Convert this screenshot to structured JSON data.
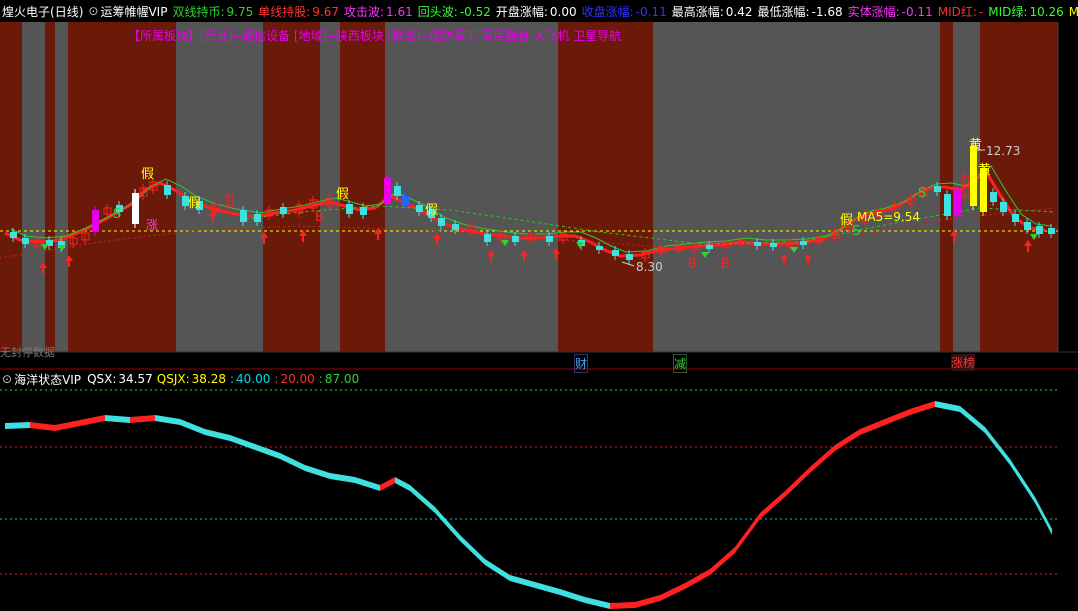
{
  "header": {
    "stock_name": "煌火电子",
    "period": "(日线)",
    "indicator_name": "运筹帷幄VIP",
    "items": [
      {
        "label": "双线持币:",
        "value": "9.75",
        "color": "#32d232"
      },
      {
        "label": "单线持股:",
        "value": "9.67",
        "color": "#ff3232"
      },
      {
        "label": "攻击波:",
        "value": "1.61",
        "color": "#ff32ff"
      },
      {
        "label": "回头波:",
        "value": "-0.52",
        "color": "#32ff32"
      },
      {
        "label": "开盘涨幅:",
        "value": "0.00",
        "color": "#ffffff"
      },
      {
        "label": "收盘涨幅:",
        "value": "-0.11",
        "color": "#3232ff"
      },
      {
        "label": "最高涨幅:",
        "value": "0.42",
        "color": "#ffffff"
      },
      {
        "label": "最低涨幅:",
        "value": "-1.68",
        "color": "#ffffff"
      },
      {
        "label": "实体涨幅:",
        "value": "-0.11",
        "color": "#ff32ff"
      },
      {
        "label": "MID红:",
        "value": "-",
        "color": "#ff3232"
      },
      {
        "label": "MID绿:",
        "value": "10.26",
        "color": "#32ff32"
      },
      {
        "label": "M",
        "value": "",
        "color": "#ffff00"
      }
    ]
  },
  "sector_line": "【所属板块】[行业]--通信设备 [地域]--陕西板块 [概念]--国防军工 军民融合 大飞机 卫星导航",
  "annotations": {
    "fake": "假",
    "buy": "B",
    "sell": "S",
    "yellow": "黄",
    "surge": "涨",
    "high_price": "12.73",
    "low_price": "8.30",
    "ma5": "MA5=9.54"
  },
  "event_markers": [
    {
      "text": "财",
      "color": "#4aa3ff"
    },
    {
      "text": "减",
      "color": "#32d232"
    },
    {
      "text": "涨榜",
      "color": "#ff3232"
    }
  ],
  "bottom_left_text": "无封停数据",
  "sub_indicator": {
    "name": "海洋状态VIP",
    "items": [
      {
        "label": "QSX:",
        "value": "34.57",
        "color": "#ffffff"
      },
      {
        "label": "QSJX:",
        "value": "38.28",
        "color": "#ffff00"
      },
      {
        "label": ":",
        "value": "40.00",
        "color": "#00e0e0"
      },
      {
        "label": ":",
        "value": "20.00",
        "color": "#ff3232"
      },
      {
        "label": ":",
        "value": "87.00",
        "color": "#32d232"
      }
    ]
  },
  "colors": {
    "zone_dark_red": "#6b1a0a",
    "zone_gray": "#555555",
    "up": "#ff2020",
    "down": "#40e0e0",
    "ma_yellow": "#ffff00",
    "ma_green": "#32c832"
  }
}
